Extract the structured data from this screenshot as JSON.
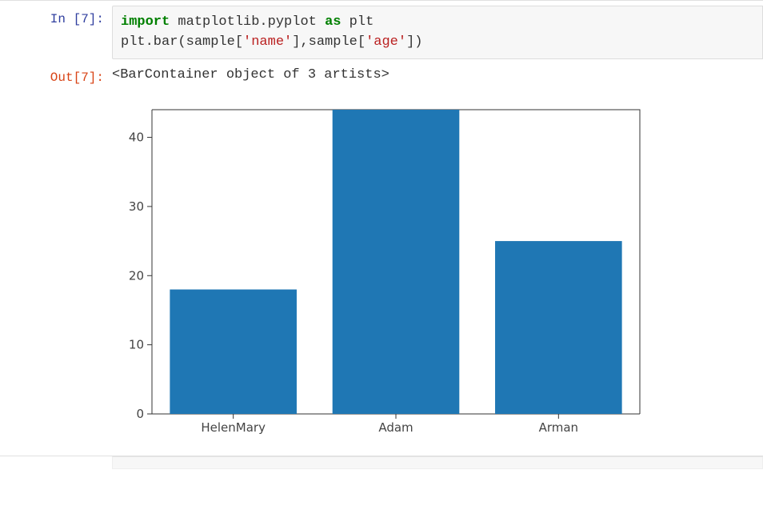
{
  "prompts": {
    "in_label": "In [7]:",
    "out_label": "Out[7]:"
  },
  "code": {
    "kw_import": "import",
    "mod": " matplotlib.pyplot ",
    "kw_as": "as",
    "alias": " plt",
    "line2_pre": "plt.bar(sample[",
    "str_name": "'name'",
    "line2_mid": "],sample[",
    "str_age": "'age'",
    "line2_post": "])"
  },
  "output_text": "<BarContainer object of 3 artists>",
  "chart_data": {
    "type": "bar",
    "categories": [
      "HelenMary",
      "Adam",
      "Arman"
    ],
    "values": [
      18,
      44,
      25
    ],
    "title": "",
    "xlabel": "",
    "ylabel": "",
    "ylim": [
      0,
      44
    ],
    "yticks": [
      0,
      10,
      20,
      30,
      40
    ]
  }
}
